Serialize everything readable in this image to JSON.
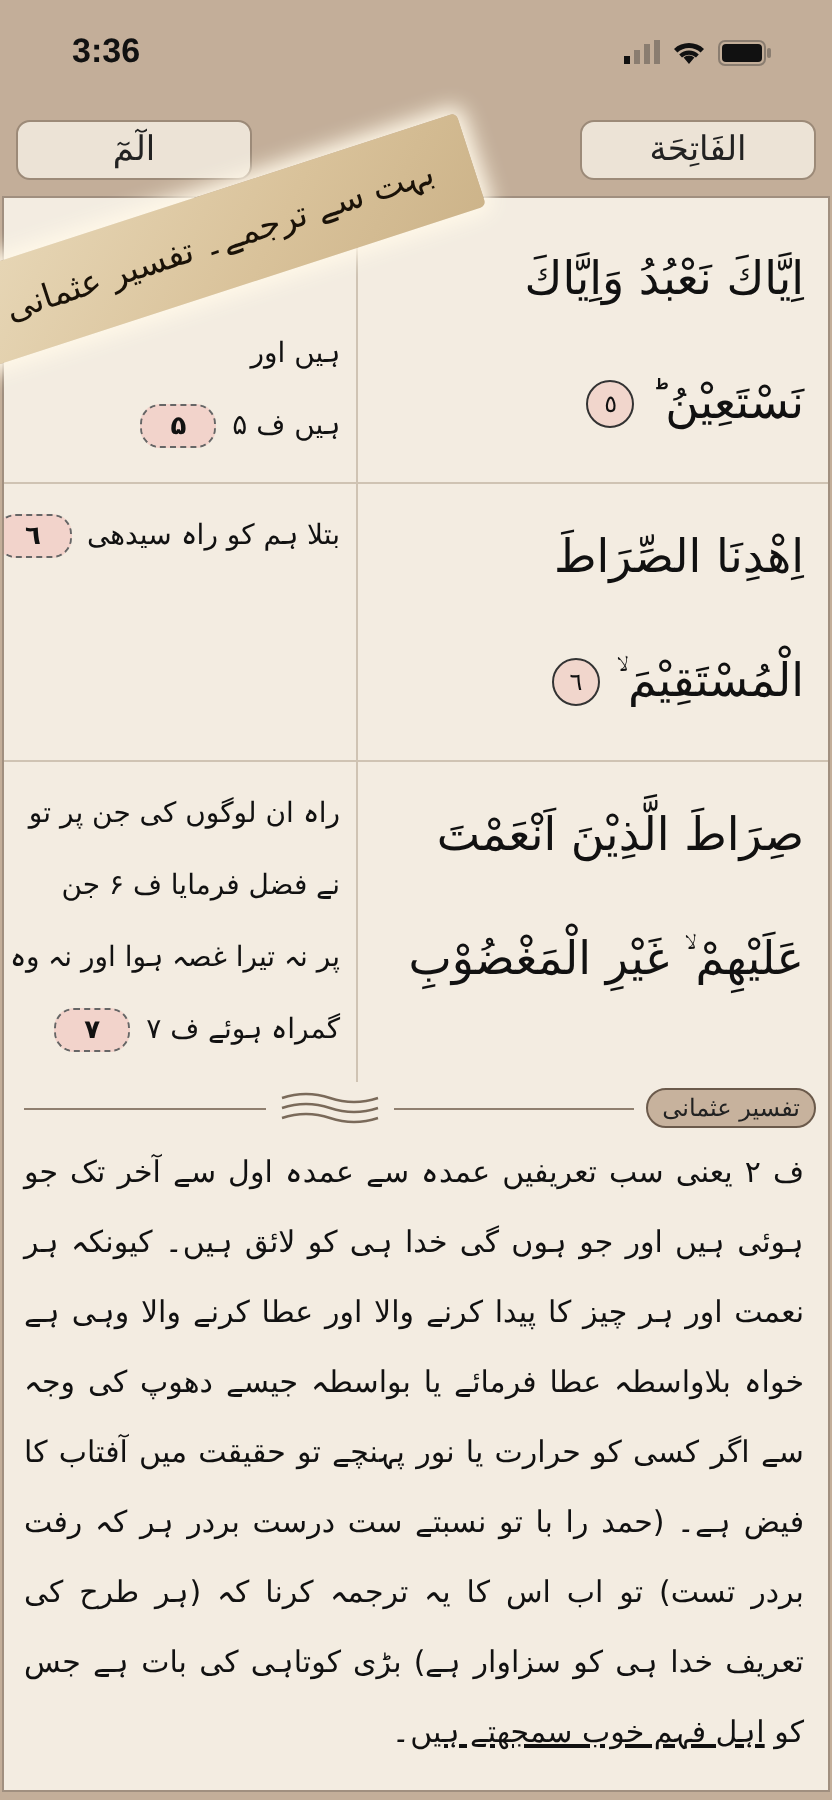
{
  "status_bar": {
    "time": "3:36"
  },
  "header": {
    "buttons": [
      {
        "label": "الفَاتِحَة"
      },
      {
        "label": "الٓمٓ"
      }
    ]
  },
  "banner": {
    "text": "بہت سے ترجمے۔ تفسیر عثمانی"
  },
  "verses": [
    {
      "arabic_lines": [
        "اِيَّاكَ نَعْبُدُ وَاِيَّاكَ",
        "نَسْتَعِيْنُ ؕ"
      ],
      "arabic_number": "٥",
      "translation_lines": [
        "ہیں اور",
        "ہیں ف ۵"
      ],
      "translation_number": "۵"
    },
    {
      "arabic_lines": [
        "اِهْدِنَا الصِّرَاطَ",
        "الْمُسْتَقِيْمَ ۙ"
      ],
      "arabic_number": "٦",
      "translation_lines": [
        "بتلا ہم کو راہ سیدھی"
      ],
      "translation_number": "٦"
    },
    {
      "arabic_lines": [
        "صِرَاطَ الَّذِيْنَ اَنْعَمْتَ",
        "عَلَيْهِمْ ۙ غَيْرِ الْمَغْضُوْبِ"
      ],
      "translation_lines": [
        "راہ ان لوگوں کی جن پر تو",
        "نے فضل فرمایا ف ۶ جن",
        "پر نہ تیرا غصہ ہوا اور نہ وہ",
        "گمراہ ہوئے ف ۷"
      ],
      "translation_number": "۷"
    }
  ],
  "tafsir": {
    "tag": "تفسیر عثمانی",
    "segments": [
      {
        "text": "ف ۲ یعنی سب تعریفیں عمدہ سے عمدہ اول سے آخر تک جو ہوئی ہیں اور جو ہوں گی خدا ہی کو لائق ہیں۔ کیونکہ ہر نعمت اور ہر چیز کا پیدا کرنے والا اور عطا کرنے والا وہی ہے خواہ بلاواسطہ عطا فرمائے یا بواسطہ جیسے دھوپ کی وجہ سے اگر کسی کو حرارت یا نور پہنچے تو حقیقت میں آفتاب کا فیض ہے۔ (حمد را با تو نسبتے ست درست بردر ہر کہ رفت بردر تست) تو اب اس کا یہ ترجمہ کرنا کہ (ہر طرح کی تعریف خدا ہی کو سزاوار ہے) بڑی کوتاہی کی بات ہے جس کو ",
        "underlined": false
      },
      {
        "text": "اہل فہم خوب سمجھتے ہیں",
        "underlined": true
      },
      {
        "text": "۔",
        "underlined": false
      }
    ]
  }
}
